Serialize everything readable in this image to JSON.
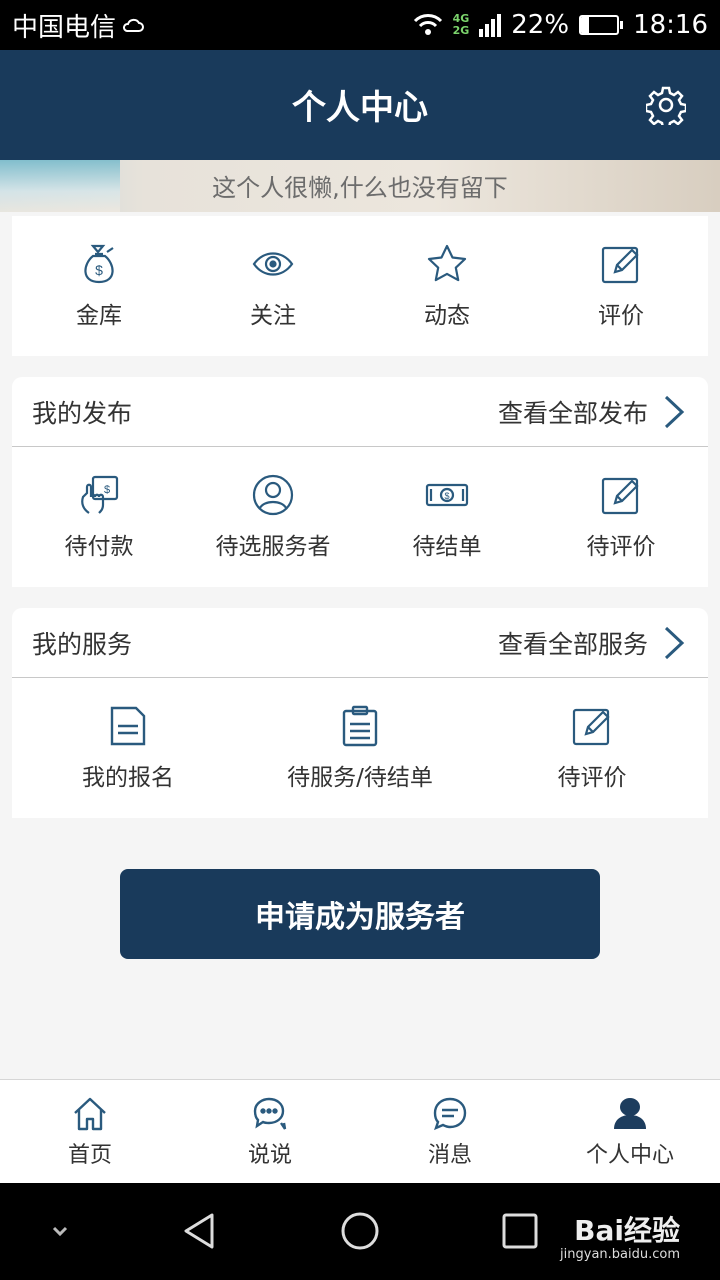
{
  "status_bar": {
    "carrier": "中国电信",
    "net_top": "4G",
    "net_bottom": "2G",
    "battery": "22%",
    "battery_level": 0.22,
    "time": "18:16"
  },
  "header": {
    "title": "个人中心",
    "settings_icon": "gear-icon"
  },
  "banner": {
    "signature": "这个人很懒,什么也没有留下"
  },
  "quick_actions": [
    {
      "label": "金库",
      "icon": "money-bag-icon"
    },
    {
      "label": "关注",
      "icon": "eye-icon"
    },
    {
      "label": "动态",
      "icon": "star-icon"
    },
    {
      "label": "评价",
      "icon": "edit-icon"
    }
  ],
  "my_posts": {
    "title": "我的发布",
    "view_all": "查看全部发布",
    "items": [
      {
        "label": "待付款",
        "icon": "touch-pay-icon"
      },
      {
        "label": "待选服务者",
        "icon": "user-circle-icon"
      },
      {
        "label": "待结单",
        "icon": "banknote-icon"
      },
      {
        "label": "待评价",
        "icon": "edit-icon"
      }
    ]
  },
  "my_services": {
    "title": "我的服务",
    "view_all": "查看全部服务",
    "items": [
      {
        "label": "我的报名",
        "icon": "document-icon"
      },
      {
        "label": "待服务/待结单",
        "icon": "clipboard-icon"
      },
      {
        "label": "待评价",
        "icon": "edit-icon"
      }
    ]
  },
  "apply_button": "申请成为服务者",
  "tabs": [
    {
      "label": "首页",
      "icon": "home-icon"
    },
    {
      "label": "说说",
      "icon": "chat-bubbles-icon"
    },
    {
      "label": "消息",
      "icon": "message-icon"
    },
    {
      "label": "个人中心",
      "icon": "person-icon",
      "active": true
    }
  ],
  "colors": {
    "primary": "#193a5b",
    "icon": "#2a5a7e"
  },
  "watermark": {
    "brand": "Bai经验",
    "url": "jingyan.baidu.com"
  }
}
